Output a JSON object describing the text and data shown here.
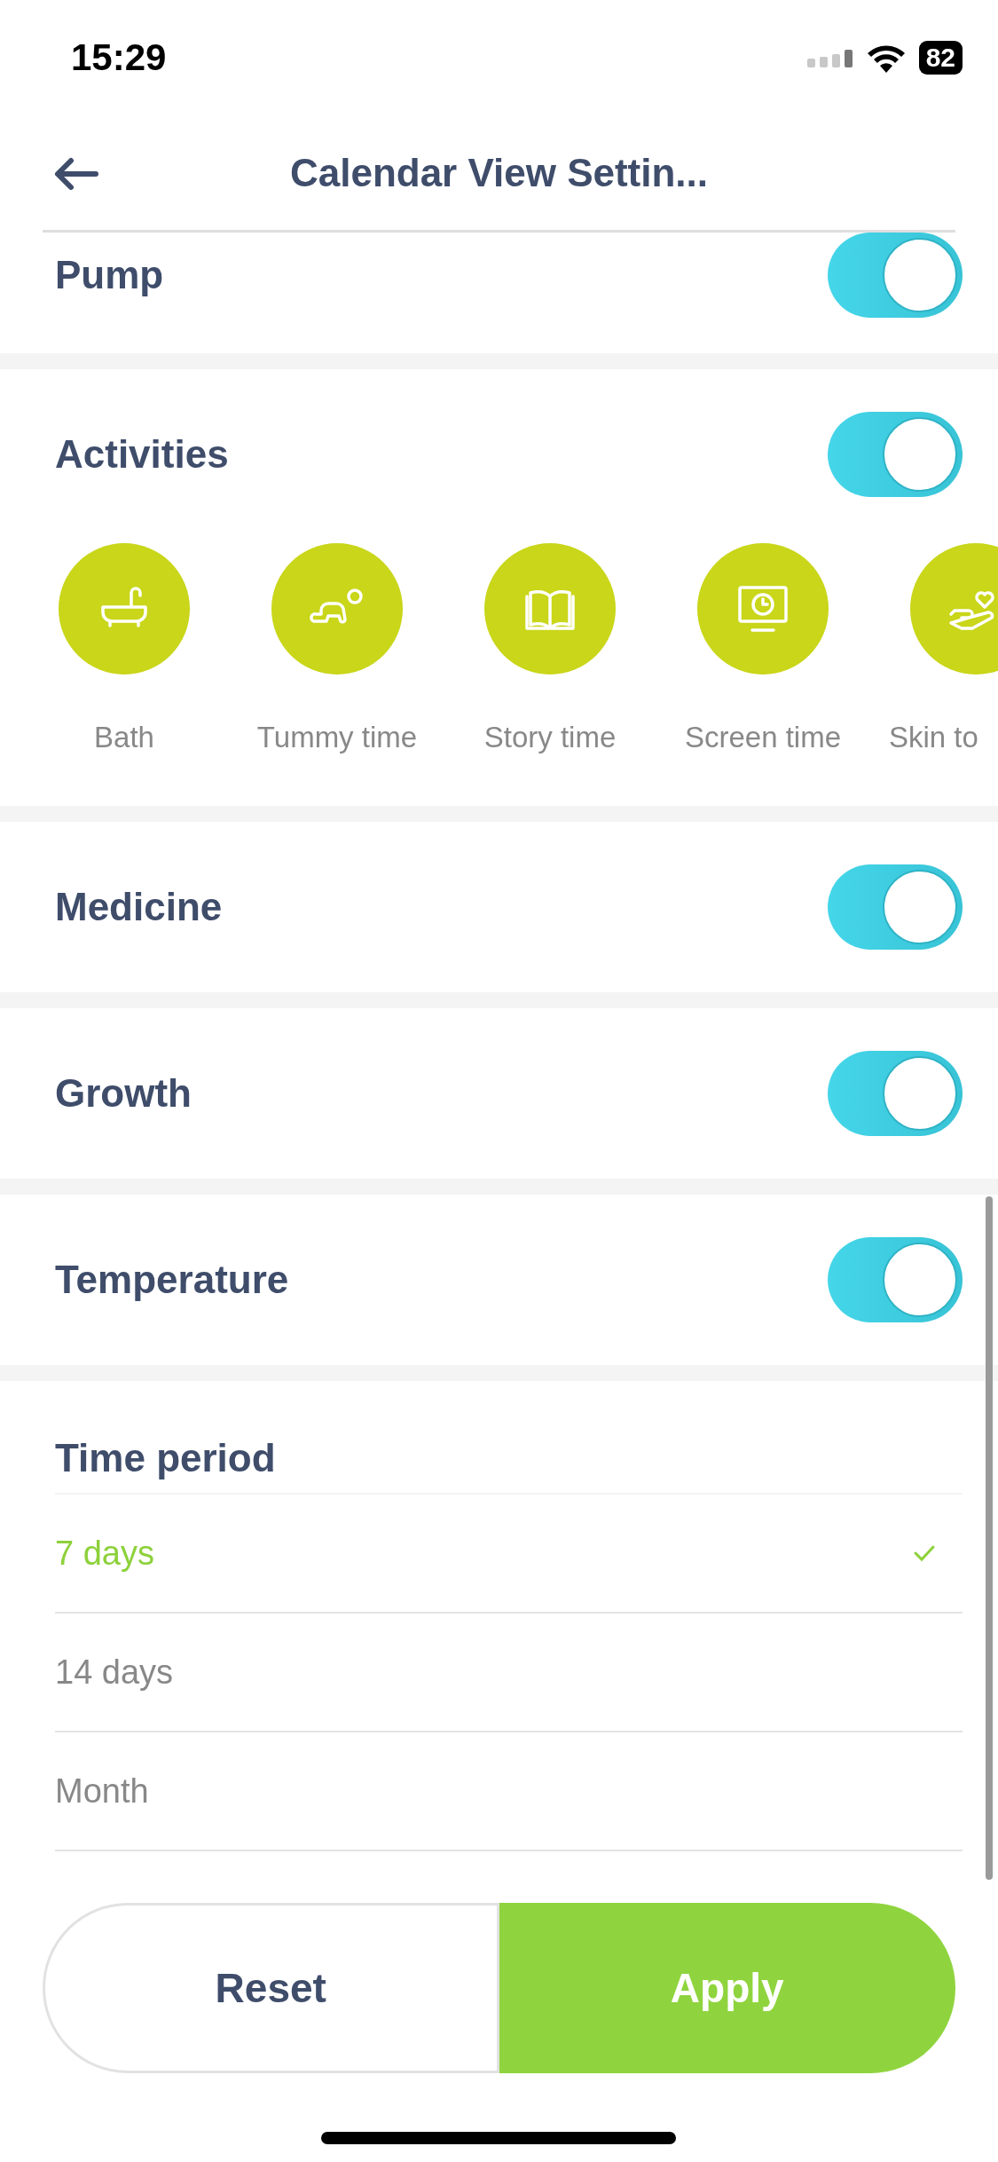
{
  "status_bar": {
    "time": "15:29",
    "battery": "82"
  },
  "header": {
    "title": "Calendar View Settin..."
  },
  "sections": [
    {
      "label": "Pump",
      "on": true
    },
    {
      "label": "Activities",
      "on": true,
      "items": [
        {
          "label": "Bath",
          "kind": "bath"
        },
        {
          "label": "Tummy time",
          "kind": "tummy"
        },
        {
          "label": "Story time",
          "kind": "story"
        },
        {
          "label": "Screen time",
          "kind": "screen"
        },
        {
          "label": "Skin to",
          "kind": "skin"
        }
      ]
    },
    {
      "label": "Medicine",
      "on": true
    },
    {
      "label": "Growth",
      "on": true
    },
    {
      "label": "Temperature",
      "on": true
    }
  ],
  "time_period": {
    "title": "Time period",
    "options": [
      {
        "label": "7 days",
        "selected": true
      },
      {
        "label": "14 days",
        "selected": false
      },
      {
        "label": "Month",
        "selected": false
      }
    ]
  },
  "buttons": [
    {
      "label": "Reset",
      "kind": "secondary"
    },
    {
      "label": "Apply",
      "kind": "primary"
    }
  ]
}
